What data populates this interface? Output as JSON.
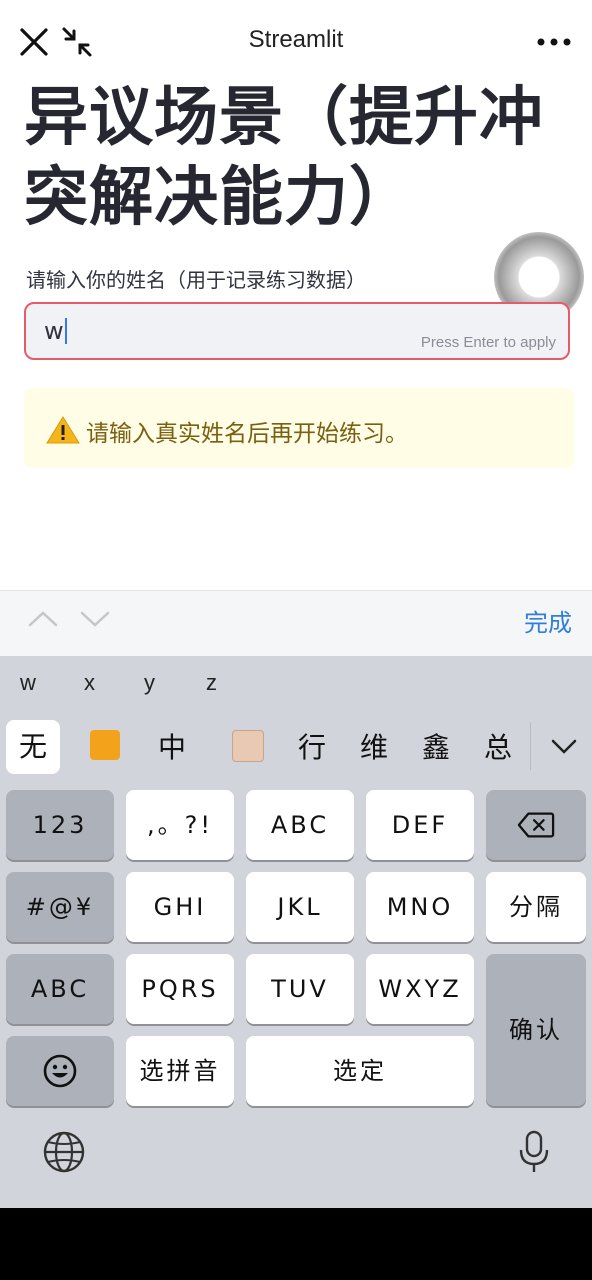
{
  "header": {
    "app_title": "Streamlit"
  },
  "page": {
    "title": "异议场景（提升冲突解决能力）",
    "name_label": "请输入你的姓名（用于记录练习数据）",
    "name_value": "w",
    "input_hint": "Press Enter to apply",
    "warning_text": "请输入真实姓名后再开始练习。"
  },
  "keyboard_toolbar": {
    "done_label": "完成"
  },
  "keyboard": {
    "pinyin_options": [
      "w",
      "x",
      "y",
      "z"
    ],
    "candidates": [
      "无",
      "中",
      "行",
      "维",
      "鑫",
      "总"
    ],
    "keys": {
      "num": "123",
      "punct": ",。?!",
      "abc": "ABC",
      "def": "DEF",
      "symbols": "#@¥",
      "ghi": "GHI",
      "jkl": "JKL",
      "mno": "MNO",
      "separator": "分隔",
      "abc_switch": "ABC",
      "pqrs": "PQRS",
      "tuv": "TUV",
      "wxyz": "WXYZ",
      "confirm": "确认",
      "select_pinyin": "选拼音",
      "select": "选定"
    }
  },
  "colors": {
    "accent": "#2f7de1",
    "input_border": "#e85a6b",
    "warning_bg": "#fffde6",
    "warning_text": "#7a6010"
  }
}
